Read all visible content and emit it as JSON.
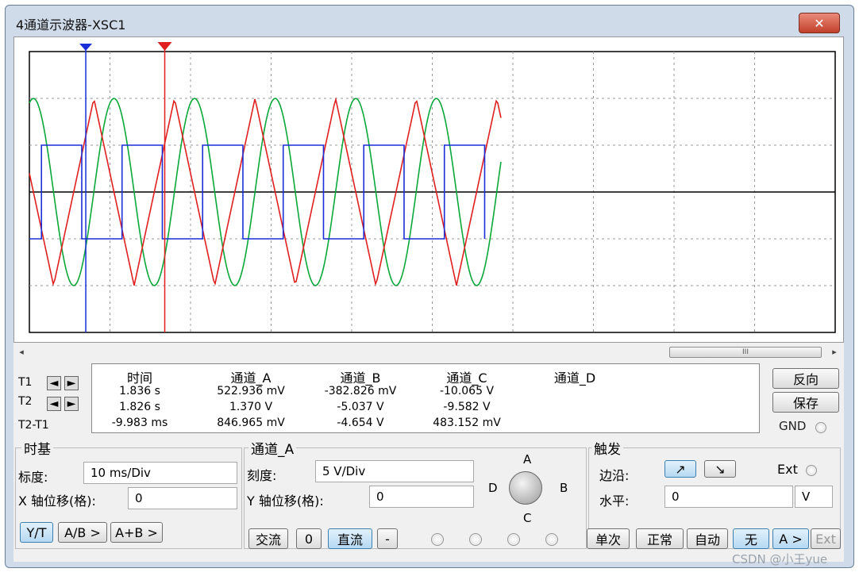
{
  "window": {
    "title": "4通道示波器-XSC1",
    "close_label": "✕"
  },
  "scrollbar": {
    "left_arrow": "◂",
    "right_arrow": "▸",
    "thumb_grip": "III"
  },
  "cursors": {
    "t1": "T1",
    "t2": "T2",
    "t2_t1": "T2-T1",
    "left_arrow": "◄",
    "right_arrow": "►"
  },
  "readout": {
    "headers": [
      "时间",
      "通道_A",
      "通道_B",
      "通道_C",
      "通道_D"
    ],
    "rows": [
      [
        "1.836 s",
        "522.936 mV",
        "-382.826 mV",
        "-10.065 V",
        ""
      ],
      [
        "1.826 s",
        "1.370 V",
        "-5.037 V",
        "-9.582 V",
        ""
      ],
      [
        "-9.983 ms",
        "846.965 mV",
        "-4.654 V",
        "483.152 mV",
        ""
      ]
    ]
  },
  "right_buttons": {
    "reverse": "反向",
    "save": "保存",
    "gnd": "GND"
  },
  "timebase": {
    "title": "时基",
    "scale_label": "标度:",
    "scale_value": "10 ms/Div",
    "xpos_label": "X 轴位移(格):",
    "xpos_value": "0",
    "modes": [
      "Y/T",
      "A/B >",
      "A+B >"
    ]
  },
  "channel": {
    "title": "通道_A",
    "scale_label": "刻度:",
    "scale_value": "5  V/Div",
    "ypos_label": "Y 轴位移(格):",
    "ypos_value": "0",
    "coupling": [
      "交流",
      "0",
      "直流",
      "-"
    ],
    "knob_labels": {
      "a": "A",
      "b": "B",
      "c": "C",
      "d": "D"
    }
  },
  "trigger": {
    "title": "触发",
    "edge_label": "边沿:",
    "edge_rise": "↗",
    "edge_fall": "↘",
    "ext_label": "Ext",
    "level_label": "水平:",
    "level_value": "0",
    "level_unit": "V",
    "modes": [
      "单次",
      "正常",
      "自动",
      "无",
      "A >",
      "Ext"
    ]
  },
  "watermark": "CSDN @小王yue",
  "colors": {
    "channel_a": "#e02020",
    "channel_b": "#0aa83a",
    "channel_c": "#1a2fd8",
    "cursor_1": "#e02020",
    "cursor_2": "#1a2fd8"
  }
}
